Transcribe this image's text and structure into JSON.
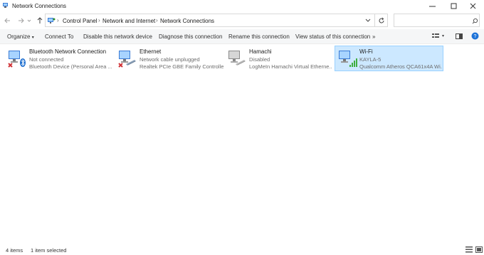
{
  "window": {
    "title": "Network Connections"
  },
  "address": {
    "crumbs": [
      "Control Panel",
      "Network and Internet",
      "Network Connections"
    ],
    "search_placeholder": ""
  },
  "toolbar": {
    "organize": "Organize",
    "connect_to": "Connect To",
    "disable": "Disable this network device",
    "diagnose": "Diagnose this connection",
    "rename": "Rename this connection",
    "view_status": "View status of this connection",
    "more": "»"
  },
  "connections": [
    {
      "name": "Bluetooth Network Connection",
      "status": "Not connected",
      "device": "Bluetooth Device (Personal Area ...",
      "icon": "bluetooth-adapter-icon",
      "selected": false
    },
    {
      "name": "Ethernet",
      "status": "Network cable unplugged",
      "device": "Realtek PCIe GBE Family Controller",
      "icon": "ethernet-adapter-icon",
      "selected": false
    },
    {
      "name": "Hamachi",
      "status": "Disabled",
      "device": "LogMeIn Hamachi Virtual Etherne...",
      "icon": "hamachi-adapter-icon",
      "selected": false
    },
    {
      "name": "Wi-Fi",
      "status": "KAYLA-5",
      "device": "Qualcomm Atheros QCA61x4A Wi...",
      "icon": "wifi-adapter-icon",
      "selected": true
    }
  ],
  "status": {
    "count": "4 items",
    "selection": "1 item selected"
  },
  "colors": {
    "selection_bg": "#cce8ff",
    "selection_border": "#99d1ff",
    "error_red": "#d13438",
    "signal_green": "#3fae3f"
  }
}
